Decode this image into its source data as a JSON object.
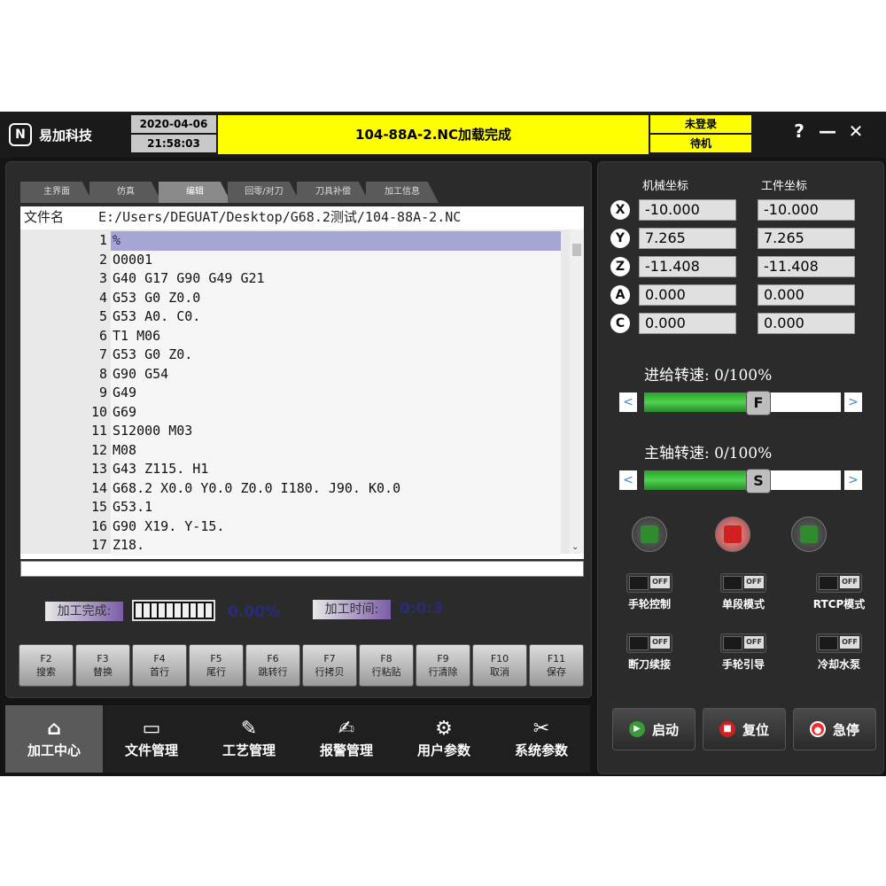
{
  "header": {
    "brand": "易加科技",
    "date": "2020-04-06",
    "time": "21:58:03",
    "message": "104-88A-2.NC加载完成",
    "login_status": "未登录",
    "machine_status": "待机",
    "help": "?",
    "minimize": "—",
    "close": "✕"
  },
  "tabs": [
    "主界面",
    "仿真",
    "编辑",
    "回零/对刀",
    "刀具补偿",
    "加工信息"
  ],
  "active_tab": "编辑",
  "editor": {
    "file_label": "文件名",
    "file_path": "E:/Users/DEGUAT/Desktop/G68.2测试/104-88A-2.NC",
    "lines": [
      {
        "n": "1",
        "code": "%"
      },
      {
        "n": "2",
        "code": "O0001"
      },
      {
        "n": "3",
        "code": "G40 G17 G90 G49 G21"
      },
      {
        "n": "4",
        "code": "G53 G0 Z0.0"
      },
      {
        "n": "5",
        "code": "G53 A0. C0."
      },
      {
        "n": "6",
        "code": "T1 M06"
      },
      {
        "n": "7",
        "code": "G53 G0 Z0."
      },
      {
        "n": "8",
        "code": "G90 G54"
      },
      {
        "n": "9",
        "code": "G49"
      },
      {
        "n": "10",
        "code": "G69"
      },
      {
        "n": "11",
        "code": "S12000 M03"
      },
      {
        "n": "12",
        "code": "M08"
      },
      {
        "n": "13",
        "code": "G43 Z115. H1"
      },
      {
        "n": "14",
        "code": "G68.2 X0.0 Y0.0 Z0.0 I180. J90. K0.0"
      },
      {
        "n": "15",
        "code": "G53.1"
      },
      {
        "n": "16",
        "code": "G90 X19. Y-15."
      },
      {
        "n": "17",
        "code": "Z18."
      }
    ]
  },
  "progress": {
    "done_label": "加工完成:",
    "done_value": "0.00%",
    "done_fraction": 0.0,
    "time_label": "加工时间:",
    "time_value": "0:0:3"
  },
  "fkeys": [
    {
      "key": "F2",
      "label": "搜索"
    },
    {
      "key": "F3",
      "label": "替换"
    },
    {
      "key": "F4",
      "label": "首行"
    },
    {
      "key": "F5",
      "label": "尾行"
    },
    {
      "key": "F6",
      "label": "跳转行"
    },
    {
      "key": "F7",
      "label": "行拷贝"
    },
    {
      "key": "F8",
      "label": "行粘贴"
    },
    {
      "key": "F9",
      "label": "行清除"
    },
    {
      "key": "F10",
      "label": "取消"
    },
    {
      "key": "F11",
      "label": "保存"
    }
  ],
  "nav": [
    {
      "label": "加工中心",
      "icon": "home-icon",
      "glyph": "⌂"
    },
    {
      "label": "文件管理",
      "icon": "folder-icon",
      "glyph": "▭"
    },
    {
      "label": "工艺管理",
      "icon": "pen-icon",
      "glyph": "✎"
    },
    {
      "label": "报警管理",
      "icon": "edit-icon",
      "glyph": "✍"
    },
    {
      "label": "用户参数",
      "icon": "user-gear-icon",
      "glyph": "⚙"
    },
    {
      "label": "系统参数",
      "icon": "tools-icon",
      "glyph": "✂"
    }
  ],
  "coords": {
    "machine_header": "机械坐标",
    "work_header": "工件坐标",
    "axes": [
      {
        "axis": "X",
        "machine": "-10.000",
        "work": "-10.000"
      },
      {
        "axis": "Y",
        "machine": "7.265",
        "work": "7.265"
      },
      {
        "axis": "Z",
        "machine": "-11.408",
        "work": "-11.408"
      },
      {
        "axis": "A",
        "machine": "0.000",
        "work": "0.000"
      },
      {
        "axis": "C",
        "machine": "0.000",
        "work": "0.000"
      }
    ]
  },
  "overrides": {
    "feed_label": "进给转速: 0/100%",
    "feed_knob": "F",
    "feed_fraction": 0.58,
    "spindle_label": "主轴转速: 0/100%",
    "spindle_knob": "S",
    "spindle_fraction": 0.58,
    "left_arrow": "<",
    "right_arrow": ">"
  },
  "toggles": [
    {
      "label": "手轮控制",
      "state": "OFF"
    },
    {
      "label": "单段模式",
      "state": "OFF"
    },
    {
      "label": "RTCP模式",
      "state": "OFF"
    },
    {
      "label": "断刀续接",
      "state": "OFF"
    },
    {
      "label": "手轮引导",
      "state": "OFF"
    },
    {
      "label": "冷却水泵",
      "state": "OFF"
    }
  ],
  "actions": {
    "start": "启动",
    "reset": "复位",
    "estop": "急停"
  },
  "colors": {
    "message_bg": "#ffff00",
    "accent_purple": "#7a5ca8",
    "slider_green": "#3cbf3c"
  }
}
